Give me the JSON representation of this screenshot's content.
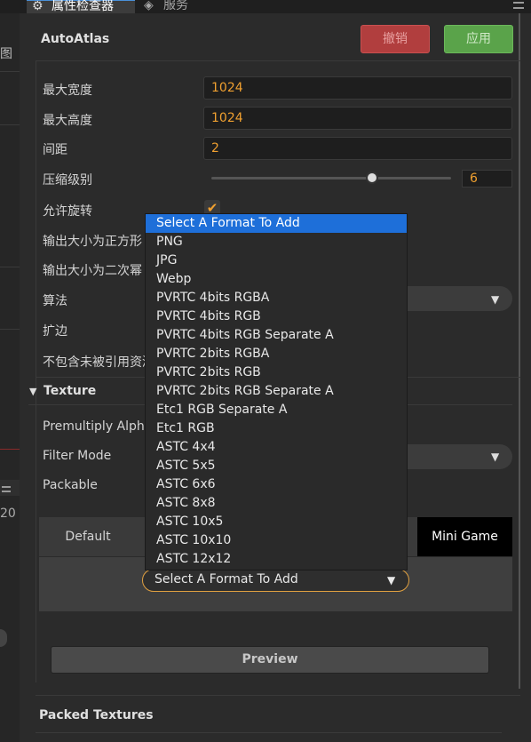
{
  "tabs": {
    "inspector": "属性检查器",
    "services": "服务"
  },
  "left_panel": {
    "glyph": "图",
    "number": "20"
  },
  "header": {
    "title": "AutoAtlas",
    "revert_label": "撤销",
    "apply_label": "应用"
  },
  "props": {
    "max_width_label": "最大宽度",
    "max_width_value": "1024",
    "max_height_label": "最大高度",
    "max_height_value": "1024",
    "padding_label": "间距",
    "padding_value": "2",
    "compress_label": "压缩级别",
    "compress_value": "6",
    "compress_fraction": 0.67,
    "rotation_label": "允许旋转",
    "rotation_checked": true,
    "square_label": "输出大小为正方形",
    "pot_label": "输出大小为二次幂",
    "algorithm_label": "算法",
    "extrude_label": "扩边",
    "exclude_label": "不包含未被引用资源"
  },
  "texture": {
    "section_title": "Texture",
    "premultiply_label": "Premultiply Alpha",
    "filter_label": "Filter Mode",
    "packable_label": "Packable"
  },
  "platforms": {
    "default_label": "Default",
    "minigame_label": "Mini Game",
    "format_select_label": "Select A Format To Add"
  },
  "dropdown": {
    "options": [
      "Select A Format To Add",
      "PNG",
      "JPG",
      "Webp",
      "PVRTC 4bits RGBA",
      "PVRTC 4bits RGB",
      "PVRTC 4bits RGB Separate A",
      "PVRTC 2bits RGBA",
      "PVRTC 2bits RGB",
      "PVRTC 2bits RGB Separate A",
      "Etc1 RGB Separate A",
      "Etc1 RGB",
      "ASTC 4x4",
      "ASTC 5x5",
      "ASTC 6x6",
      "ASTC 8x8",
      "ASTC 10x5",
      "ASTC 10x10",
      "ASTC 12x12"
    ],
    "selected_index": 0
  },
  "footer": {
    "preview_label": "Preview",
    "packed_title": "Packed Textures"
  },
  "colors": {
    "accent": "#f0a030",
    "selection": "#1e6fd9",
    "revert": "#b13e3e",
    "apply": "#5aa34a"
  }
}
